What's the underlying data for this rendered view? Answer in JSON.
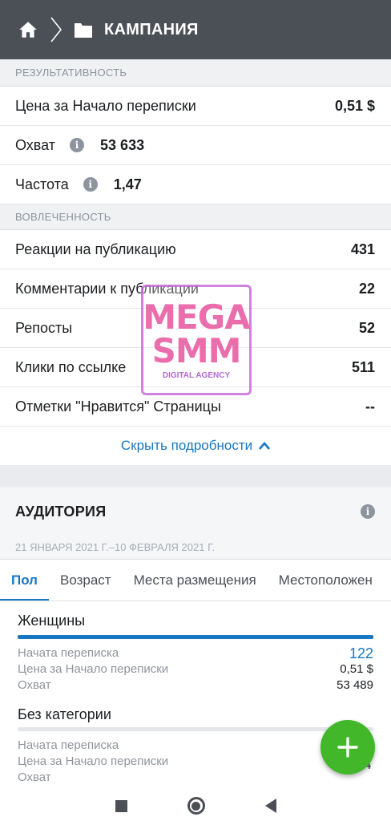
{
  "header": {
    "title": "КАМПАНИЯ",
    "icons": [
      "home-icon",
      "chevron-right-icon",
      "folder-icon"
    ]
  },
  "performance": {
    "section_title": "РЕЗУЛЬТАТИВНОСТЬ",
    "rows": [
      {
        "label": "Цена за Начало переписки",
        "value": "0,51 $"
      },
      {
        "label": "Охват",
        "value": "53 633"
      },
      {
        "label": "Частота",
        "value": "1,47"
      }
    ]
  },
  "engagement": {
    "section_title": "ВОВЛЕЧЕННОСТЬ",
    "rows": [
      {
        "label": "Реакции на публикацию",
        "value": "431"
      },
      {
        "label": "Комментарии к публикации",
        "value": "22"
      },
      {
        "label": "Репосты",
        "value": "52"
      },
      {
        "label": "Клики по ссылке",
        "value": "511"
      },
      {
        "label": "Отметки \"Нравится\" Страницы",
        "value": "--"
      }
    ]
  },
  "hide_details": "Скрыть подробности",
  "audience": {
    "title": "АУДИТОРИЯ",
    "date_range": "21 ЯНВАРЯ 2021 Г.–10 ФЕВРАЛЯ 2021 Г.",
    "tabs": [
      "Пол",
      "Возраст",
      "Места размещения",
      "Местоположен"
    ],
    "active_tab": "Пол",
    "categories": [
      {
        "name": "Женщины",
        "bar_fraction": 1.0,
        "metrics": [
          {
            "label": "Начата переписка",
            "value": "122"
          },
          {
            "label": "Цена за Начало переписки",
            "value": "0,51 $"
          },
          {
            "label": "Охват",
            "value": "53 489"
          }
        ]
      },
      {
        "name": "Без категории",
        "bar_fraction": 0.0,
        "metrics": [
          {
            "label": "Начата переписка",
            "value": ""
          },
          {
            "label": "Цена за Начало переписки",
            "value": ""
          },
          {
            "label": "Охват",
            "value": "4"
          }
        ]
      }
    ]
  },
  "watermark": {
    "line1": "MEGA",
    "line2": "SMM",
    "line3": "DIGITAL AGENCY"
  },
  "colors": {
    "accent": "#1877c2",
    "fab": "#42b72a",
    "topbar": "#4b4f56"
  }
}
